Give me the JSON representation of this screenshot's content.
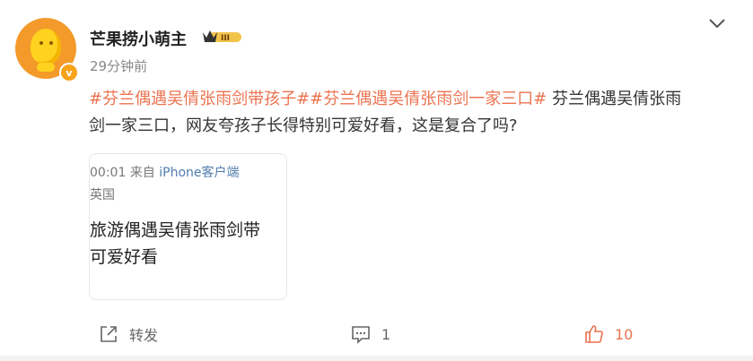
{
  "post": {
    "username": "芒果捞小萌主",
    "vip_level": "III",
    "time": "29分钟前",
    "tags": [
      "#芬兰偶遇吴倩张雨剑带孩子#",
      "#芬兰偶遇吴倩张雨剑一家三口#"
    ],
    "text_line1_tail": " 芬兰偶遇吴倩张雨",
    "text_line2": "剑一家三口，网友夸孩子长得特别可爱好看，这是复合了吗?"
  },
  "card": {
    "time_fragment": "00:01",
    "from_label": "来自",
    "source": "iPhone客户端",
    "location": "英国",
    "text_line1": "旅游偶遇吴倩张雨剑带",
    "text_line2": "可爱好看"
  },
  "actions": {
    "forward_label": "转发",
    "comment_count": "1",
    "like_count": "10"
  },
  "colors": {
    "accent": "#eb7350",
    "link": "#507daf",
    "badge": "#f7a21b"
  },
  "icons": [
    "avatar-image",
    "verified-badge",
    "vip-badge",
    "more-chevron-icon",
    "forward-icon",
    "comment-icon",
    "like-icon"
  ]
}
